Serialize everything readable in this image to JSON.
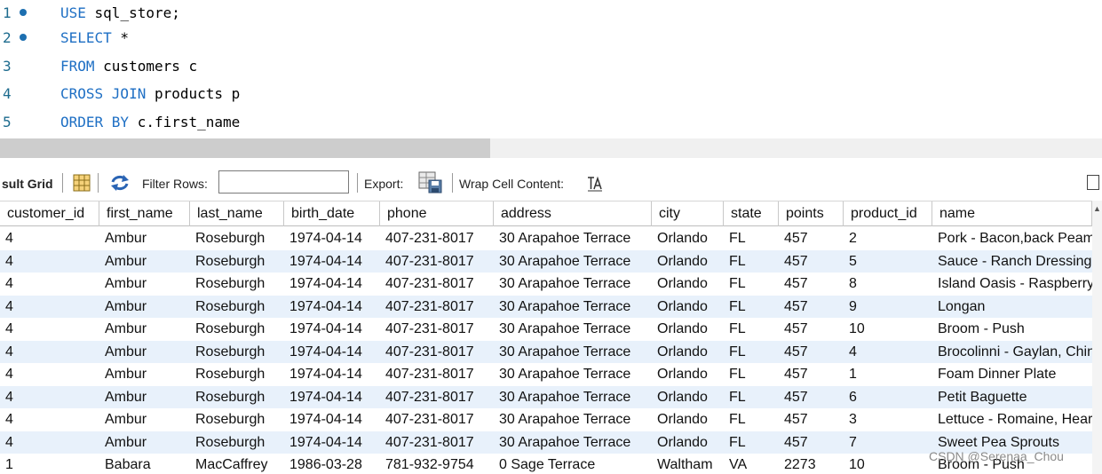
{
  "editor": {
    "lines": [
      {
        "num": "1",
        "marker": true,
        "parts": [
          {
            "t": "USE",
            "kw": true
          },
          {
            "t": " sql_store;",
            "kw": false
          }
        ]
      },
      {
        "num": "2",
        "marker": true,
        "parts": [
          {
            "t": "SELECT",
            "kw": true
          },
          {
            "t": " *",
            "kw": false
          }
        ]
      },
      {
        "num": "3",
        "marker": false,
        "parts": [
          {
            "t": "FROM",
            "kw": true
          },
          {
            "t": " customers c",
            "kw": false
          }
        ]
      },
      {
        "num": "4",
        "marker": false,
        "parts": [
          {
            "t": "CROSS JOIN",
            "kw": true
          },
          {
            "t": " products p",
            "kw": false
          }
        ]
      },
      {
        "num": "5",
        "marker": false,
        "parts": [
          {
            "t": "ORDER BY",
            "kw": true
          },
          {
            "t": " c.first_name",
            "kw": false
          }
        ]
      }
    ]
  },
  "toolbar": {
    "result_grid_label": "sult Grid",
    "filter_rows_label": "Filter Rows:",
    "filter_value": "",
    "export_label": "Export:",
    "wrap_label": "Wrap Cell Content:"
  },
  "grid": {
    "columns": [
      "customer_id",
      "first_name",
      "last_name",
      "birth_date",
      "phone",
      "address",
      "city",
      "state",
      "points",
      "product_id",
      "name"
    ],
    "rows": [
      [
        "4",
        "Ambur",
        "Roseburgh",
        "1974-04-14",
        "407-231-8017",
        "30 Arapahoe Terrace",
        "Orlando",
        "FL",
        "457",
        "2",
        "Pork - Bacon,back Peam"
      ],
      [
        "4",
        "Ambur",
        "Roseburgh",
        "1974-04-14",
        "407-231-8017",
        "30 Arapahoe Terrace",
        "Orlando",
        "FL",
        "457",
        "5",
        "Sauce - Ranch Dressing"
      ],
      [
        "4",
        "Ambur",
        "Roseburgh",
        "1974-04-14",
        "407-231-8017",
        "30 Arapahoe Terrace",
        "Orlando",
        "FL",
        "457",
        "8",
        "Island Oasis - Raspberry"
      ],
      [
        "4",
        "Ambur",
        "Roseburgh",
        "1974-04-14",
        "407-231-8017",
        "30 Arapahoe Terrace",
        "Orlando",
        "FL",
        "457",
        "9",
        "Longan"
      ],
      [
        "4",
        "Ambur",
        "Roseburgh",
        "1974-04-14",
        "407-231-8017",
        "30 Arapahoe Terrace",
        "Orlando",
        "FL",
        "457",
        "10",
        "Broom - Push"
      ],
      [
        "4",
        "Ambur",
        "Roseburgh",
        "1974-04-14",
        "407-231-8017",
        "30 Arapahoe Terrace",
        "Orlando",
        "FL",
        "457",
        "4",
        "Brocolinni - Gaylan, Chin"
      ],
      [
        "4",
        "Ambur",
        "Roseburgh",
        "1974-04-14",
        "407-231-8017",
        "30 Arapahoe Terrace",
        "Orlando",
        "FL",
        "457",
        "1",
        "Foam Dinner Plate"
      ],
      [
        "4",
        "Ambur",
        "Roseburgh",
        "1974-04-14",
        "407-231-8017",
        "30 Arapahoe Terrace",
        "Orlando",
        "FL",
        "457",
        "6",
        "Petit Baguette"
      ],
      [
        "4",
        "Ambur",
        "Roseburgh",
        "1974-04-14",
        "407-231-8017",
        "30 Arapahoe Terrace",
        "Orlando",
        "FL",
        "457",
        "3",
        "Lettuce - Romaine, Hear"
      ],
      [
        "4",
        "Ambur",
        "Roseburgh",
        "1974-04-14",
        "407-231-8017",
        "30 Arapahoe Terrace",
        "Orlando",
        "FL",
        "457",
        "7",
        "Sweet Pea Sprouts"
      ],
      [
        "1",
        "Babara",
        "MacCaffrey",
        "1986-03-28",
        "781-932-9754",
        "0 Sage Terrace",
        "Waltham",
        "VA",
        "2273",
        "10",
        "Broom - Push"
      ]
    ]
  },
  "watermark": "CSDN @Serenaa_Chou",
  "colors": {
    "keyword": "#1e6fc4",
    "row_alt": "#e8f1fb",
    "line_number": "#1d6b8e"
  }
}
